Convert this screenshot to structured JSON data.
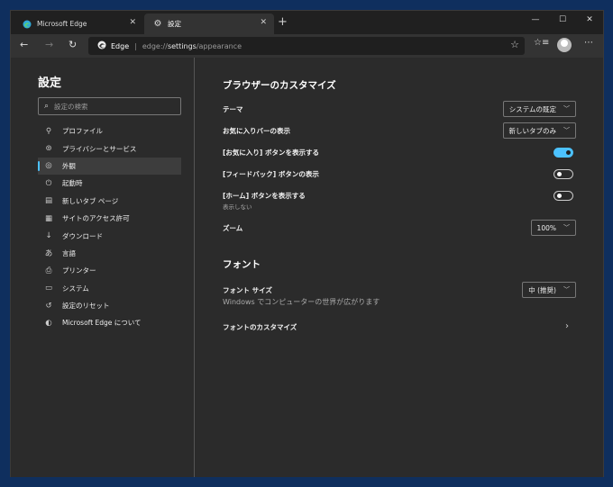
{
  "tabs": [
    {
      "title": "Microsoft Edge",
      "icon": "edge-icon"
    },
    {
      "title": "設定",
      "icon": "gear-icon"
    }
  ],
  "window_controls": {
    "minimize": "—",
    "maximize": "☐",
    "close": "✕"
  },
  "toolbar": {
    "site_name": "Edge",
    "url_prefix": "edge://",
    "url_host": "settings",
    "url_path": "/appearance"
  },
  "sidebar": {
    "title": "設定",
    "search_placeholder": "設定の検索",
    "items": [
      {
        "label": "プロファイル",
        "icon": "person-icon"
      },
      {
        "label": "プライバシーとサービス",
        "icon": "lock-icon"
      },
      {
        "label": "外観",
        "icon": "palette-icon"
      },
      {
        "label": "起動時",
        "icon": "power-icon"
      },
      {
        "label": "新しいタブ ページ",
        "icon": "newtab-icon"
      },
      {
        "label": "サイトのアクセス許可",
        "icon": "permissions-icon"
      },
      {
        "label": "ダウンロード",
        "icon": "download-icon"
      },
      {
        "label": "言語",
        "icon": "language-icon"
      },
      {
        "label": "プリンター",
        "icon": "printer-icon"
      },
      {
        "label": "システム",
        "icon": "system-icon"
      },
      {
        "label": "設定のリセット",
        "icon": "reset-icon"
      },
      {
        "label": "Microsoft Edge について",
        "icon": "edge-icon"
      }
    ],
    "active_index": 2
  },
  "main": {
    "section1_title": "ブラウザーのカスタマイズ",
    "theme": {
      "label": "テーマ",
      "value": "システムの既定"
    },
    "favorites_bar": {
      "label": "お気に入りバーの表示",
      "value": "新しいタブのみ"
    },
    "favorites_button": {
      "label": "[お気に入り] ボタンを表示する",
      "on": true
    },
    "feedback_button": {
      "label": "[フィードバック] ボタンの表示",
      "on": false
    },
    "home_button": {
      "label": "[ホーム] ボタンを表示する",
      "sublabel": "表示しない",
      "on": false
    },
    "zoom": {
      "label": "ズーム",
      "value": "100%"
    },
    "section2_title": "フォント",
    "font_size": {
      "label": "フォント サイズ",
      "value": "中 (推奨)",
      "preview": "Windows でコンピューターの世界が広がります"
    },
    "customize_fonts": {
      "label": "フォントのカスタマイズ"
    }
  },
  "colors": {
    "accent": "#4cc2ff",
    "background": "#2b2b2b",
    "titlebar": "#202020",
    "desktop": "#0f2f5e"
  }
}
